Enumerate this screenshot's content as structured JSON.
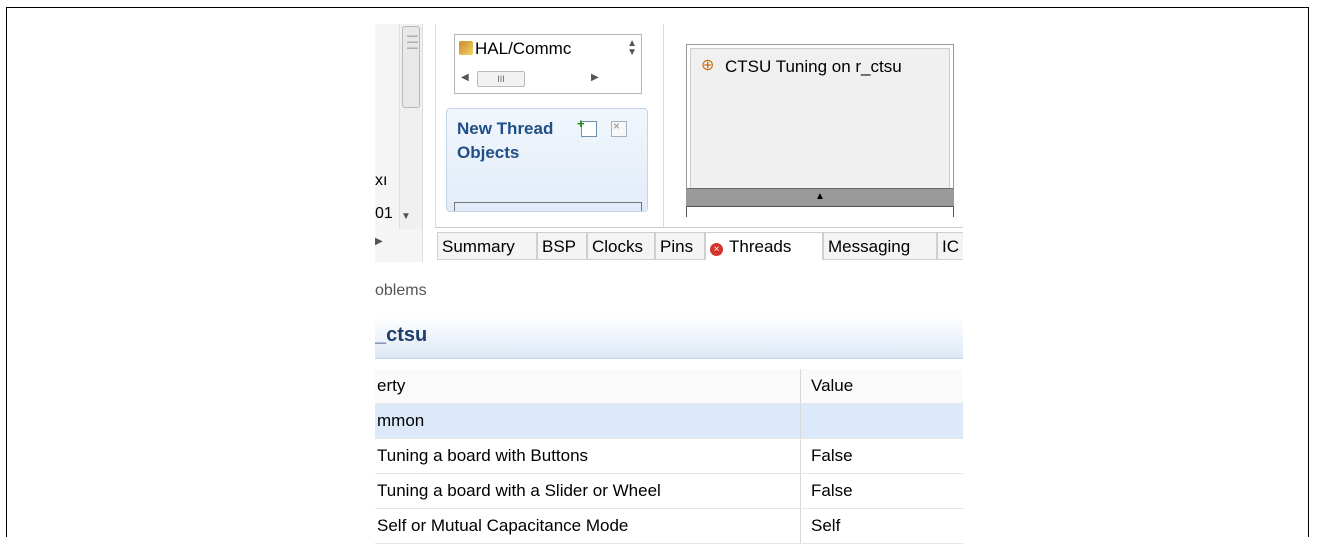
{
  "left_panel": {
    "text_line1": "xı",
    "text_line2": "01"
  },
  "palette": {
    "combo_value": "HAL/Commc",
    "new_thread_label": "New Thread Objects"
  },
  "canvas": {
    "block_title": "CTSU Tuning on r_ctsu"
  },
  "tabs": [
    {
      "label": "Summary"
    },
    {
      "label": "BSP"
    },
    {
      "label": "Clocks"
    },
    {
      "label": "Pins"
    },
    {
      "label": "Threads",
      "active": true,
      "error": true
    },
    {
      "label": "Messaging"
    },
    {
      "label": "IC"
    }
  ],
  "problems_label": "oblems",
  "properties": {
    "title": "_ctsu",
    "columns": [
      "erty",
      "Value"
    ],
    "rows": [
      {
        "name": "mmon",
        "value": ""
      },
      {
        "name": "Tuning a board with Buttons",
        "value": "False"
      },
      {
        "name": "Tuning a board with a Slider or Wheel",
        "value": "False"
      },
      {
        "name": "Self or Mutual Capacitance Mode",
        "value": "Self"
      }
    ]
  }
}
